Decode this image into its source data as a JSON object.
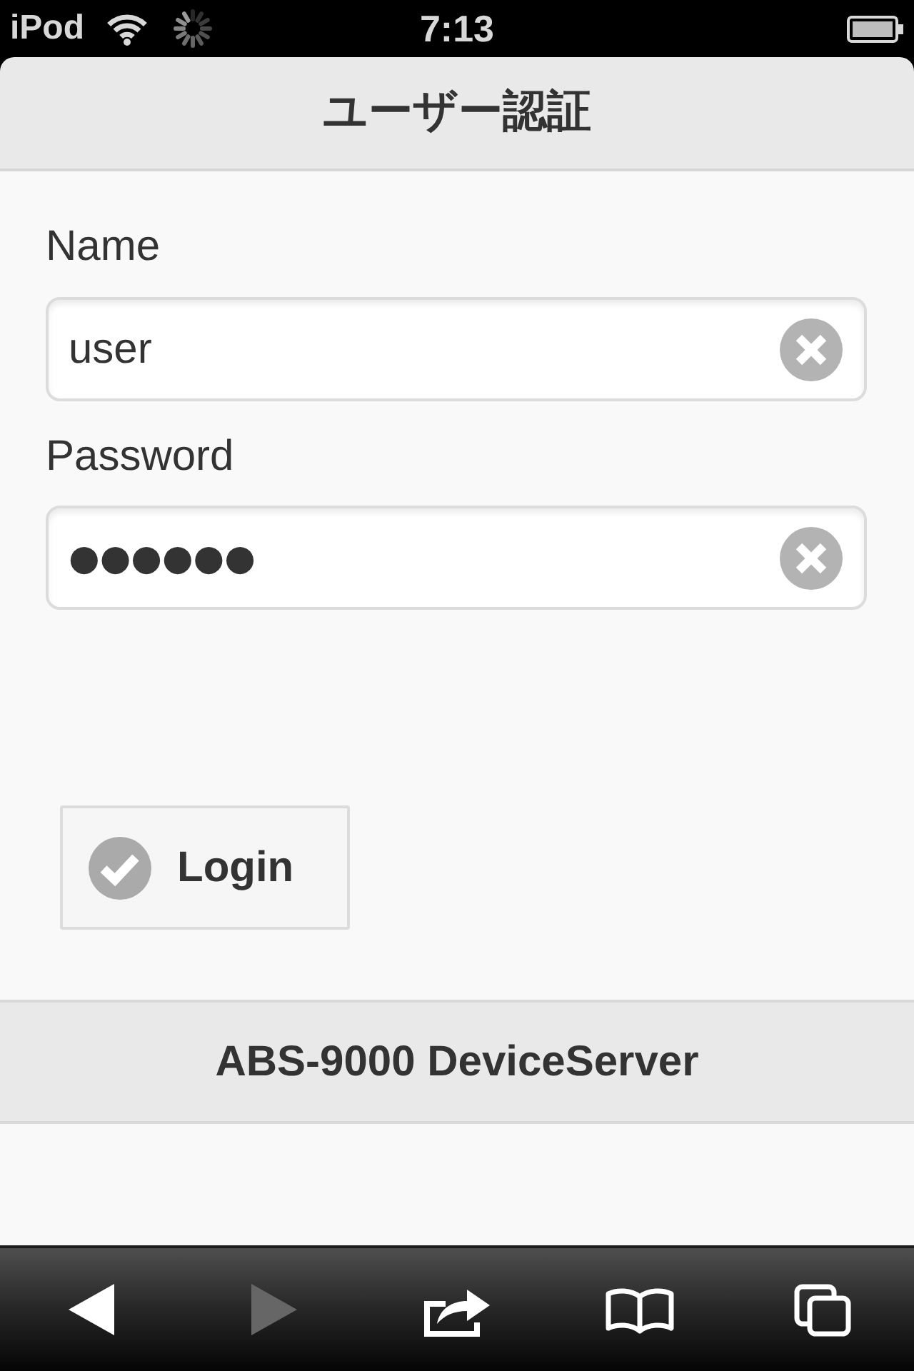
{
  "status_bar": {
    "carrier": "iPod",
    "loading": true,
    "time": "7:13"
  },
  "header": {
    "title": "ユーザー認証"
  },
  "form": {
    "fields": [
      {
        "kind": "text",
        "label": "Name",
        "value": "user"
      },
      {
        "kind": "password",
        "label": "Password",
        "value": "●●●●●●"
      }
    ]
  },
  "login_button": {
    "label": "Login"
  },
  "footer": {
    "title": "ABS-9000 DeviceServer"
  },
  "toolbar": {
    "buttons": [
      {
        "kind": "back",
        "disabled": false
      },
      {
        "kind": "forward",
        "disabled": true
      },
      {
        "kind": "share",
        "disabled": false
      },
      {
        "kind": "bookmarks",
        "disabled": false
      },
      {
        "kind": "tabs",
        "disabled": false
      }
    ]
  }
}
